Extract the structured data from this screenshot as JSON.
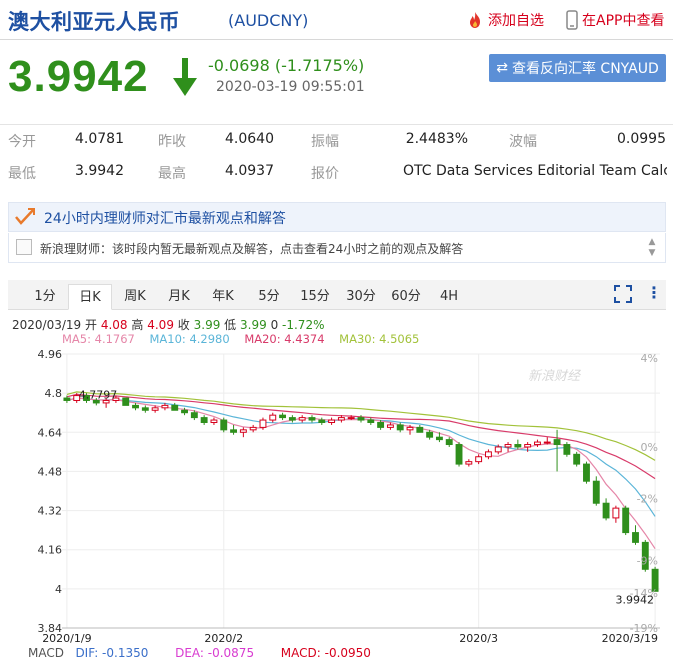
{
  "header": {
    "name": "澳大利亚元人民币",
    "code": "(AUDCNY)",
    "add_fav": "添加自选",
    "open_app": "在APP中查看"
  },
  "quote": {
    "price": "3.9942",
    "change": "-0.0698 (-1.7175%)",
    "time": "2020-03-19 09:55:01",
    "reverse_btn": "查看反向汇率 CNYAUD",
    "trend": "down"
  },
  "stats": [
    [
      {
        "label": "今开",
        "value": "4.0781"
      },
      {
        "label": "昨收",
        "value": "4.0640"
      },
      {
        "label": "振幅",
        "value": "2.4483%"
      },
      {
        "label": "波幅",
        "value": "0.0995"
      }
    ],
    [
      {
        "label": "最低",
        "value": "3.9942"
      },
      {
        "label": "最高",
        "value": "4.0937"
      },
      {
        "label": "报价",
        "value": "OTC Data Services Editorial Team Calc..."
      }
    ]
  ],
  "analyst": {
    "title": "24小时内理财师对汇市最新观点和解答",
    "message": "新浪理财师：该时段内暂无最新观点及解答，点击查看24小时之前的观点及解答"
  },
  "tabs": [
    "1分",
    "日K",
    "周K",
    "月K",
    "年K",
    "5分",
    "15分",
    "30分",
    "60分",
    "4H"
  ],
  "active_tab": "日K",
  "ohlc": {
    "date": "2020/03/19",
    "open_label": "开",
    "open": "4.08",
    "high_label": "高",
    "high": "4.09",
    "close_label": "收",
    "close": "3.99",
    "low_label": "低",
    "low": "3.99",
    "vol": "0",
    "pct": "-1.72%"
  },
  "ma": {
    "ma5": "MA5: 4.1767",
    "ma10": "MA10: 4.2980",
    "ma20": "MA20: 4.4374",
    "ma30": "MA30: 4.5065"
  },
  "macd": {
    "label": "MACD",
    "dif": "DIF: -0.1350",
    "dea": "DEA: -0.0875",
    "value": "MACD: -0.0950"
  },
  "colors": {
    "up": "#d6001c",
    "down": "#2f8f1c",
    "brand": "#1e50a2",
    "ma5": "#e586a8",
    "ma10": "#5bb5d8",
    "ma20": "#d83b6a",
    "ma30": "#a2c23a"
  },
  "chart_data": {
    "type": "candlestick",
    "y_ticks": [
      "4.96",
      "4.8",
      "4.64",
      "4.48",
      "4.32",
      "4.16",
      "4",
      "3.84"
    ],
    "pct_ticks": [
      "4%",
      "0%",
      "-2%",
      "-9%",
      "-14%",
      "-19%"
    ],
    "ylim": [
      3.84,
      4.96
    ],
    "x_ticks": [
      "2020/1/9",
      "2020/2",
      "2020/3",
      "2020/3/19"
    ],
    "annotations": {
      "start_close": "4.7797",
      "last_close": "3.9942"
    },
    "watermark": "新浪财经",
    "candles": [
      [
        4.78,
        4.79,
        4.76,
        4.77
      ],
      [
        4.77,
        4.8,
        4.76,
        4.79
      ],
      [
        4.79,
        4.8,
        4.76,
        4.77
      ],
      [
        4.77,
        4.78,
        4.75,
        4.76
      ],
      [
        4.76,
        4.78,
        4.74,
        4.77
      ],
      [
        4.77,
        4.79,
        4.76,
        4.78
      ],
      [
        4.78,
        4.78,
        4.75,
        4.75
      ],
      [
        4.75,
        4.76,
        4.73,
        4.74
      ],
      [
        4.74,
        4.75,
        4.72,
        4.73
      ],
      [
        4.73,
        4.75,
        4.72,
        4.74
      ],
      [
        4.74,
        4.76,
        4.73,
        4.75
      ],
      [
        4.75,
        4.76,
        4.73,
        4.73
      ],
      [
        4.73,
        4.74,
        4.71,
        4.72
      ],
      [
        4.72,
        4.73,
        4.69,
        4.7
      ],
      [
        4.7,
        4.71,
        4.67,
        4.68
      ],
      [
        4.68,
        4.7,
        4.67,
        4.69
      ],
      [
        4.69,
        4.7,
        4.64,
        4.65
      ],
      [
        4.65,
        4.67,
        4.63,
        4.64
      ],
      [
        4.64,
        4.66,
        4.62,
        4.65
      ],
      [
        4.65,
        4.67,
        4.64,
        4.66
      ],
      [
        4.66,
        4.7,
        4.65,
        4.69
      ],
      [
        4.69,
        4.72,
        4.68,
        4.71
      ],
      [
        4.71,
        4.72,
        4.69,
        4.7
      ],
      [
        4.7,
        4.71,
        4.68,
        4.69
      ],
      [
        4.69,
        4.71,
        4.68,
        4.7
      ],
      [
        4.7,
        4.71,
        4.68,
        4.69
      ],
      [
        4.69,
        4.7,
        4.67,
        4.68
      ],
      [
        4.68,
        4.7,
        4.67,
        4.69
      ],
      [
        4.69,
        4.71,
        4.68,
        4.7
      ],
      [
        4.7,
        4.71,
        4.69,
        4.7
      ],
      [
        4.7,
        4.71,
        4.68,
        4.69
      ],
      [
        4.69,
        4.7,
        4.67,
        4.68
      ],
      [
        4.68,
        4.69,
        4.65,
        4.66
      ],
      [
        4.66,
        4.68,
        4.65,
        4.67
      ],
      [
        4.67,
        4.68,
        4.64,
        4.65
      ],
      [
        4.65,
        4.67,
        4.63,
        4.66
      ],
      [
        4.66,
        4.67,
        4.64,
        4.64
      ],
      [
        4.64,
        4.65,
        4.61,
        4.62
      ],
      [
        4.62,
        4.64,
        4.6,
        4.61
      ],
      [
        4.61,
        4.62,
        4.58,
        4.59
      ],
      [
        4.59,
        4.6,
        4.5,
        4.51
      ],
      [
        4.51,
        4.53,
        4.5,
        4.52
      ],
      [
        4.52,
        4.55,
        4.51,
        4.54
      ],
      [
        4.54,
        4.57,
        4.53,
        4.56
      ],
      [
        4.56,
        4.59,
        4.55,
        4.58
      ],
      [
        4.58,
        4.6,
        4.56,
        4.59
      ],
      [
        4.59,
        4.61,
        4.57,
        4.58
      ],
      [
        4.58,
        4.6,
        4.56,
        4.59
      ],
      [
        4.59,
        4.61,
        4.58,
        4.6
      ],
      [
        4.6,
        4.62,
        4.59,
        4.6
      ],
      [
        4.61,
        4.65,
        4.48,
        4.59
      ],
      [
        4.59,
        4.6,
        4.54,
        4.55
      ],
      [
        4.55,
        4.56,
        4.5,
        4.51
      ],
      [
        4.51,
        4.52,
        4.43,
        4.44
      ],
      [
        4.44,
        4.46,
        4.34,
        4.35
      ],
      [
        4.35,
        4.37,
        4.28,
        4.29
      ],
      [
        4.29,
        4.34,
        4.27,
        4.33
      ],
      [
        4.33,
        4.34,
        4.22,
        4.23
      ],
      [
        4.23,
        4.26,
        4.18,
        4.19
      ],
      [
        4.19,
        4.2,
        4.07,
        4.08
      ],
      [
        4.08,
        4.09,
        3.99,
        3.99
      ]
    ]
  }
}
